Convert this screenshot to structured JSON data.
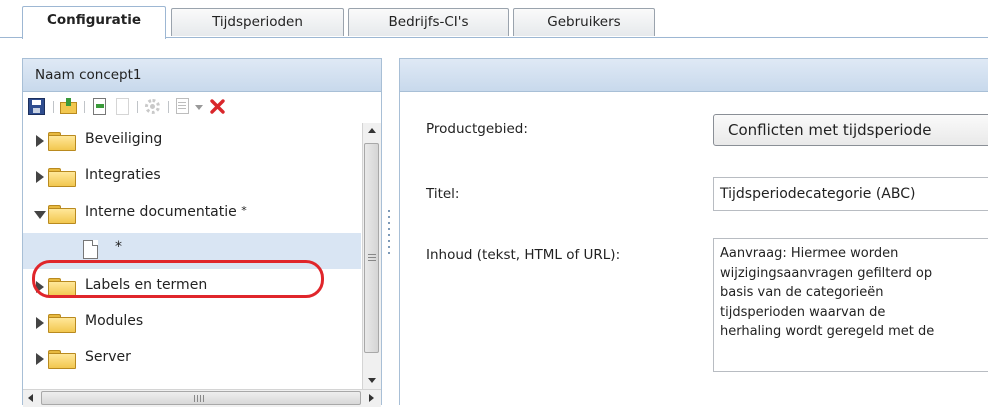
{
  "tabs": [
    {
      "label": "Configuratie",
      "active": true
    },
    {
      "label": "Tijdsperioden",
      "active": false
    },
    {
      "label": "Bedrijfs-CI's",
      "active": false
    },
    {
      "label": "Gebruikers",
      "active": false
    }
  ],
  "left_panel": {
    "title": "Naam concept1",
    "toolbar": [
      "save-icon",
      "import-icon",
      "export-icon",
      "export-disabled-icon",
      "settings-icon",
      "add-item-icon",
      "dropdown-icon",
      "delete-icon"
    ],
    "tree": [
      {
        "label": "Beveiliging",
        "expanded": false
      },
      {
        "label": "Integraties",
        "expanded": false
      },
      {
        "label": "Interne documentatie",
        "suffix": "*",
        "expanded": true,
        "highlighted": true
      },
      {
        "label": "*",
        "type": "document",
        "selected": true
      },
      {
        "label": "Labels en termen",
        "expanded": false
      },
      {
        "label": "Modules",
        "expanded": false
      },
      {
        "label": "Server",
        "expanded": false
      }
    ]
  },
  "form": {
    "product_area_label": "Productgebied:",
    "product_area_value": "Conflicten met tijdsperiode",
    "title_label": "Titel:",
    "title_value": "Tijdsperiodecategorie (ABC)",
    "content_label": "Inhoud (tekst, HTML of URL):",
    "content_value": "Aanvraag: Hiermee worden\nwijzigingsaanvragen gefilterd op\nbasis van de categorieën\ntijdsperioden waarvan de\nherhaling wordt geregeld met de"
  },
  "colors": {
    "highlight": "#e0262b",
    "panel_header": "#c8d9ec",
    "delete": "#d9262b"
  }
}
